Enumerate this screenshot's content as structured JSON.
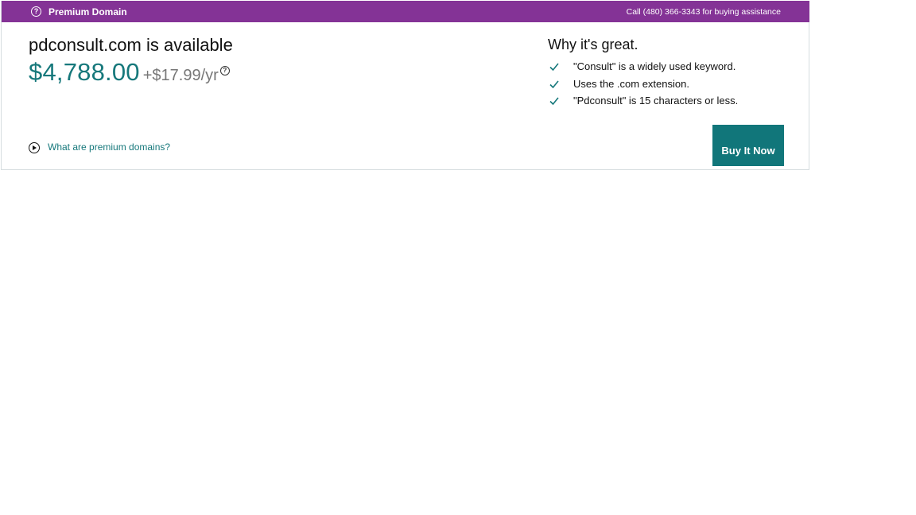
{
  "banner": {
    "title": "Premium Domain",
    "help_icon": "question-circle-icon",
    "call_text": "Call (480) 366-3343 for buying assistance"
  },
  "listing": {
    "headline": "pdconsult.com is available",
    "price": "$4,788.00",
    "renewal": "+$17.99/yr",
    "price_help_icon": "question-circle-icon"
  },
  "why_great": {
    "title": "Why it's great.",
    "reasons": [
      "\"Consult\" is a widely used keyword.",
      "Uses the .com extension.",
      "\"Pdconsult\" is 15 characters or less."
    ],
    "check_icon": "check-icon"
  },
  "premium_info": {
    "link_text": "What are premium domains?",
    "icon": "play-circle-icon"
  },
  "actions": {
    "buy_label": "Buy It Now"
  },
  "colors": {
    "banner_bg": "#843396",
    "accent_teal": "#16787b",
    "button_bg": "#11767a"
  }
}
